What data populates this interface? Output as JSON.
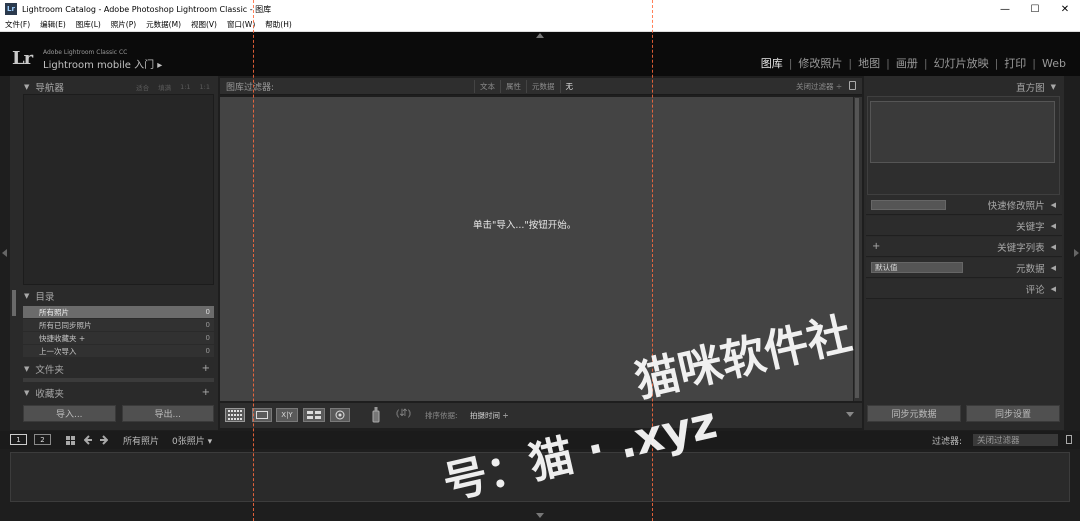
{
  "window": {
    "title": "Lightroom Catalog - Adobe Photoshop Lightroom Classic - 图库",
    "app_icon": "Lr",
    "controls": [
      "—",
      "☐",
      "✕"
    ]
  },
  "menu": [
    "文件(F)",
    "编辑(E)",
    "图库(L)",
    "照片(P)",
    "元数据(M)",
    "视图(V)",
    "窗口(W)",
    "帮助(H)"
  ],
  "identity": {
    "logo": "Lr",
    "product": "Adobe Lightroom Classic CC",
    "mobile": "Lightroom mobile 入门 ▸"
  },
  "modules": {
    "items": [
      "图库",
      "修改照片",
      "地图",
      "画册",
      "幻灯片放映",
      "打印",
      "Web"
    ],
    "separator": "|",
    "active": "图库"
  },
  "left": {
    "navigator": {
      "title": "导航器",
      "zoom": [
        "适合",
        "填满",
        "1:1",
        "1:1"
      ]
    },
    "catalog": {
      "title": "目录",
      "items": [
        {
          "label": "所有照片",
          "count": "0"
        },
        {
          "label": "所有已同步照片",
          "count": "0"
        },
        {
          "label": "快捷收藏夹 +",
          "count": "0"
        },
        {
          "label": "上一次导入",
          "count": "0"
        }
      ]
    },
    "folders": {
      "title": "文件夹",
      "plus": "+"
    },
    "collections": {
      "title": "收藏夹",
      "plus": "+"
    },
    "import_button": "导入...",
    "export_button": "导出..."
  },
  "filter_bar": {
    "title": "图库过滤器:",
    "tabs": [
      "文本",
      "属性",
      "元数据",
      "无"
    ],
    "active_tab": "无",
    "off_label": "关闭过滤器 ÷"
  },
  "grid": {
    "empty_message": "单击\"导入...\"按钮开始。"
  },
  "toolbar": {
    "view_buttons": [
      "grid-view",
      "loupe-view",
      "compare-view",
      "survey-view",
      "people-view"
    ],
    "compare_label": "X|Y",
    "sort_label": "排序依据:",
    "sort_value": "拍摄时间 ÷"
  },
  "right": {
    "histogram": {
      "title": "直方图"
    },
    "panels": [
      "快速修改照片",
      "关键字",
      "关键字列表",
      "元数据",
      "评论"
    ],
    "metadata_preset": "默认值",
    "kw_plus": "+",
    "sync_metadata": "同步元数据",
    "sync_settings": "同步设置"
  },
  "filmstrip_bar": {
    "screen1": "1",
    "screen2": "2",
    "source": "所有照片",
    "count": "0张照片 ▾",
    "filter_label": "过滤器:",
    "filter_value": "关闭过滤器"
  },
  "watermark": {
    "line1": "猫咪软件社",
    "line2": "号：猫 ·        .xyz"
  },
  "colors": {
    "background": "#1e1e1e",
    "panel": "#2a2a2a",
    "grid": "#444444",
    "selected_row": "#6b6b6b",
    "guide": "#ff6a3d"
  }
}
